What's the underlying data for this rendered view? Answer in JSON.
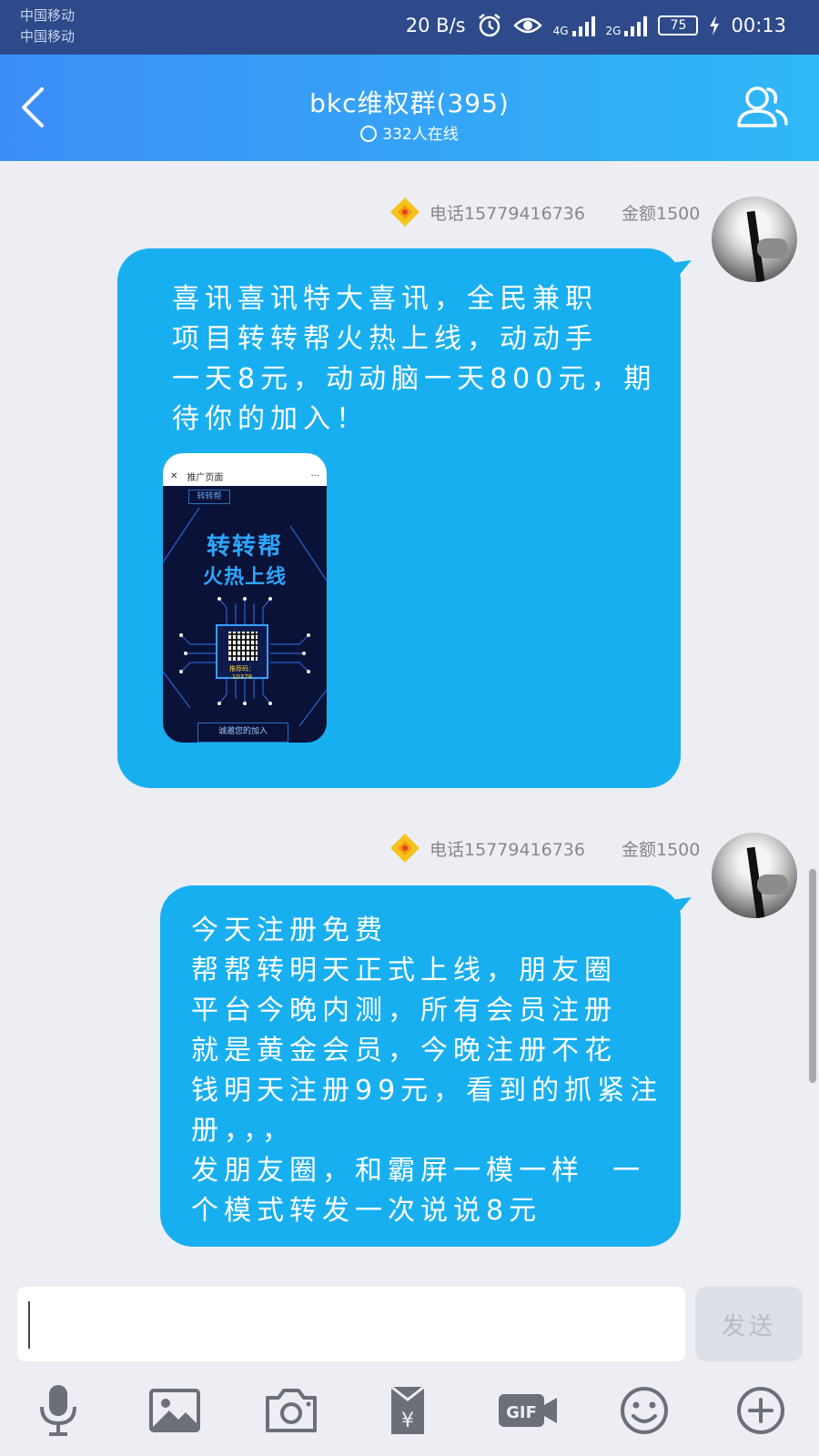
{
  "status_bar": {
    "carrier_1": "中国移动",
    "carrier_2": "中国移动",
    "net_speed": "20 B/s",
    "net_4g": "4G",
    "net_2g": "2G",
    "battery": "75",
    "time": "00:13"
  },
  "header": {
    "title": "bkc维权群(395)",
    "online": "332人在线"
  },
  "messages": [
    {
      "sender_phone": "电话15779416736",
      "sender_amount": "金额1500",
      "text": "喜讯喜讯特大喜讯，全民兼职\n项目转转帮火热上线，动动手\n一天8元，动动脑一天800元，期\n待你的加入！",
      "poster": {
        "tab_title": "推广页面",
        "tag": "转转帮",
        "line1": "转转帮",
        "line2": "火热上线",
        "code_label": "推荐码：10379",
        "footer": "诚邀您的加入"
      }
    },
    {
      "sender_phone": "电话15779416736",
      "sender_amount": "金额1500",
      "text": "今天注册免费\n帮帮转明天正式上线，朋友圈\n平台今晚内测，所有会员注册\n就是黄金会员，今晚注册不花\n钱明天注册99元，看到的抓紧注\n册，，，\n发朋友圈，和霸屏一模一样  一\n个模式转发一次说说8元"
    }
  ],
  "input": {
    "value": "",
    "send_label": "发送"
  },
  "toolbar": {
    "gif_label": "GIF",
    "icons": [
      "microphone-icon",
      "image-icon",
      "camera-icon",
      "red-packet-icon",
      "gif-icon",
      "emoji-icon",
      "plus-icon"
    ]
  },
  "colors": {
    "header_start": "#3c8ef7",
    "header_end": "#2fb8f7",
    "bubble": "#18aff0",
    "status_bar": "#2f4a8a",
    "background": "#eceef4"
  }
}
